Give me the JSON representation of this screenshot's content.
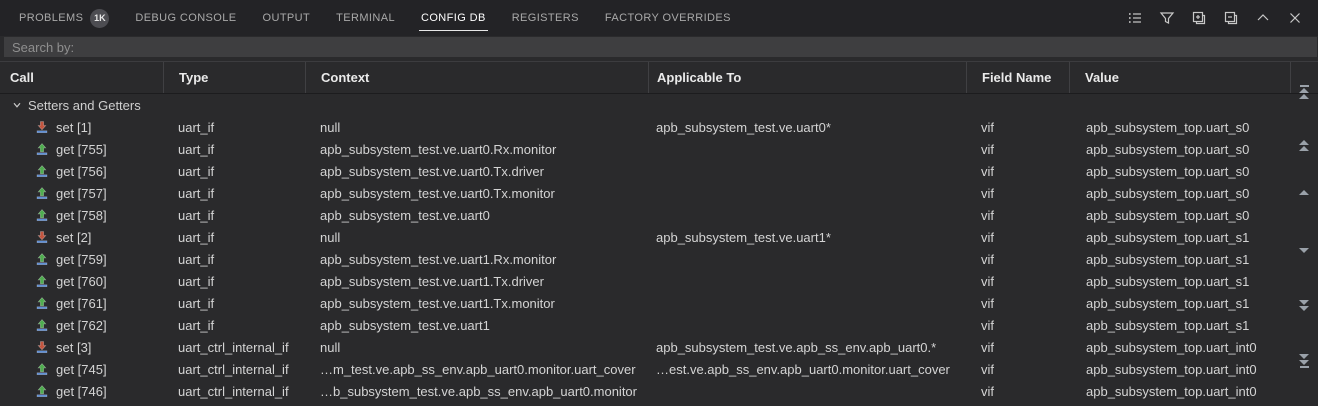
{
  "tabs": {
    "active": "CONFIG DB",
    "items": [
      {
        "label": "PROBLEMS",
        "badge": "1K"
      },
      {
        "label": "DEBUG CONSOLE"
      },
      {
        "label": "OUTPUT"
      },
      {
        "label": "TERMINAL"
      },
      {
        "label": "CONFIG DB"
      },
      {
        "label": "REGISTERS"
      },
      {
        "label": "FACTORY OVERRIDES"
      }
    ]
  },
  "toolbar": {
    "icons": [
      "list-view-icon",
      "filter-icon",
      "new-window-plus-icon",
      "restore-windows-icon",
      "chevron-up-icon",
      "close-icon"
    ]
  },
  "search": {
    "placeholder": "Search by:",
    "value": ""
  },
  "colors": {
    "set_arrow": "#c4553f",
    "get_arrow": "#4fae4f",
    "icon_bar": "#5b8dd6"
  },
  "table": {
    "columns": [
      "Call",
      "Type",
      "Context",
      "Applicable To",
      "Field Name",
      "Value"
    ],
    "group_label": "Setters and Getters",
    "rows": [
      {
        "kind": "set",
        "call": "set [1]",
        "type": "uart_if",
        "context": "null",
        "applicable_to": "apb_subsystem_test.ve.uart0*",
        "field_name": "vif",
        "value": "apb_subsystem_top.uart_s0"
      },
      {
        "kind": "get",
        "call": "get [755]",
        "type": "uart_if",
        "context": "apb_subsystem_test.ve.uart0.Rx.monitor",
        "applicable_to": "",
        "field_name": "vif",
        "value": "apb_subsystem_top.uart_s0"
      },
      {
        "kind": "get",
        "call": "get [756]",
        "type": "uart_if",
        "context": "apb_subsystem_test.ve.uart0.Tx.driver",
        "applicable_to": "",
        "field_name": "vif",
        "value": "apb_subsystem_top.uart_s0"
      },
      {
        "kind": "get",
        "call": "get [757]",
        "type": "uart_if",
        "context": "apb_subsystem_test.ve.uart0.Tx.monitor",
        "applicable_to": "",
        "field_name": "vif",
        "value": "apb_subsystem_top.uart_s0"
      },
      {
        "kind": "get",
        "call": "get [758]",
        "type": "uart_if",
        "context": "apb_subsystem_test.ve.uart0",
        "applicable_to": "",
        "field_name": "vif",
        "value": "apb_subsystem_top.uart_s0"
      },
      {
        "kind": "set",
        "call": "set [2]",
        "type": "uart_if",
        "context": "null",
        "applicable_to": "apb_subsystem_test.ve.uart1*",
        "field_name": "vif",
        "value": "apb_subsystem_top.uart_s1"
      },
      {
        "kind": "get",
        "call": "get [759]",
        "type": "uart_if",
        "context": "apb_subsystem_test.ve.uart1.Rx.monitor",
        "applicable_to": "",
        "field_name": "vif",
        "value": "apb_subsystem_top.uart_s1"
      },
      {
        "kind": "get",
        "call": "get [760]",
        "type": "uart_if",
        "context": "apb_subsystem_test.ve.uart1.Tx.driver",
        "applicable_to": "",
        "field_name": "vif",
        "value": "apb_subsystem_top.uart_s1"
      },
      {
        "kind": "get",
        "call": "get [761]",
        "type": "uart_if",
        "context": "apb_subsystem_test.ve.uart1.Tx.monitor",
        "applicable_to": "",
        "field_name": "vif",
        "value": "apb_subsystem_top.uart_s1"
      },
      {
        "kind": "get",
        "call": "get [762]",
        "type": "uart_if",
        "context": "apb_subsystem_test.ve.uart1",
        "applicable_to": "",
        "field_name": "vif",
        "value": "apb_subsystem_top.uart_s1"
      },
      {
        "kind": "set",
        "call": "set [3]",
        "type": "uart_ctrl_internal_if",
        "context": "null",
        "applicable_to": "apb_subsystem_test.ve.apb_ss_env.apb_uart0.*",
        "field_name": "vif",
        "value": "apb_subsystem_top.uart_int0"
      },
      {
        "kind": "get",
        "call": "get [745]",
        "type": "uart_ctrl_internal_if",
        "context": "…m_test.ve.apb_ss_env.apb_uart0.monitor.uart_cover",
        "applicable_to": "…est.ve.apb_ss_env.apb_uart0.monitor.uart_cover",
        "field_name": "vif",
        "value": "apb_subsystem_top.uart_int0"
      },
      {
        "kind": "get",
        "call": "get [746]",
        "type": "uart_ctrl_internal_if",
        "context": "…b_subsystem_test.ve.apb_ss_env.apb_uart0.monitor",
        "applicable_to": "",
        "field_name": "vif",
        "value": "apb_subsystem_top.uart_int0"
      }
    ]
  },
  "scroll_nav": {
    "buttons": [
      "scroll-to-top",
      "fast-scroll-up",
      "scroll-up",
      "scroll-down",
      "fast-scroll-down",
      "scroll-to-bottom"
    ]
  }
}
